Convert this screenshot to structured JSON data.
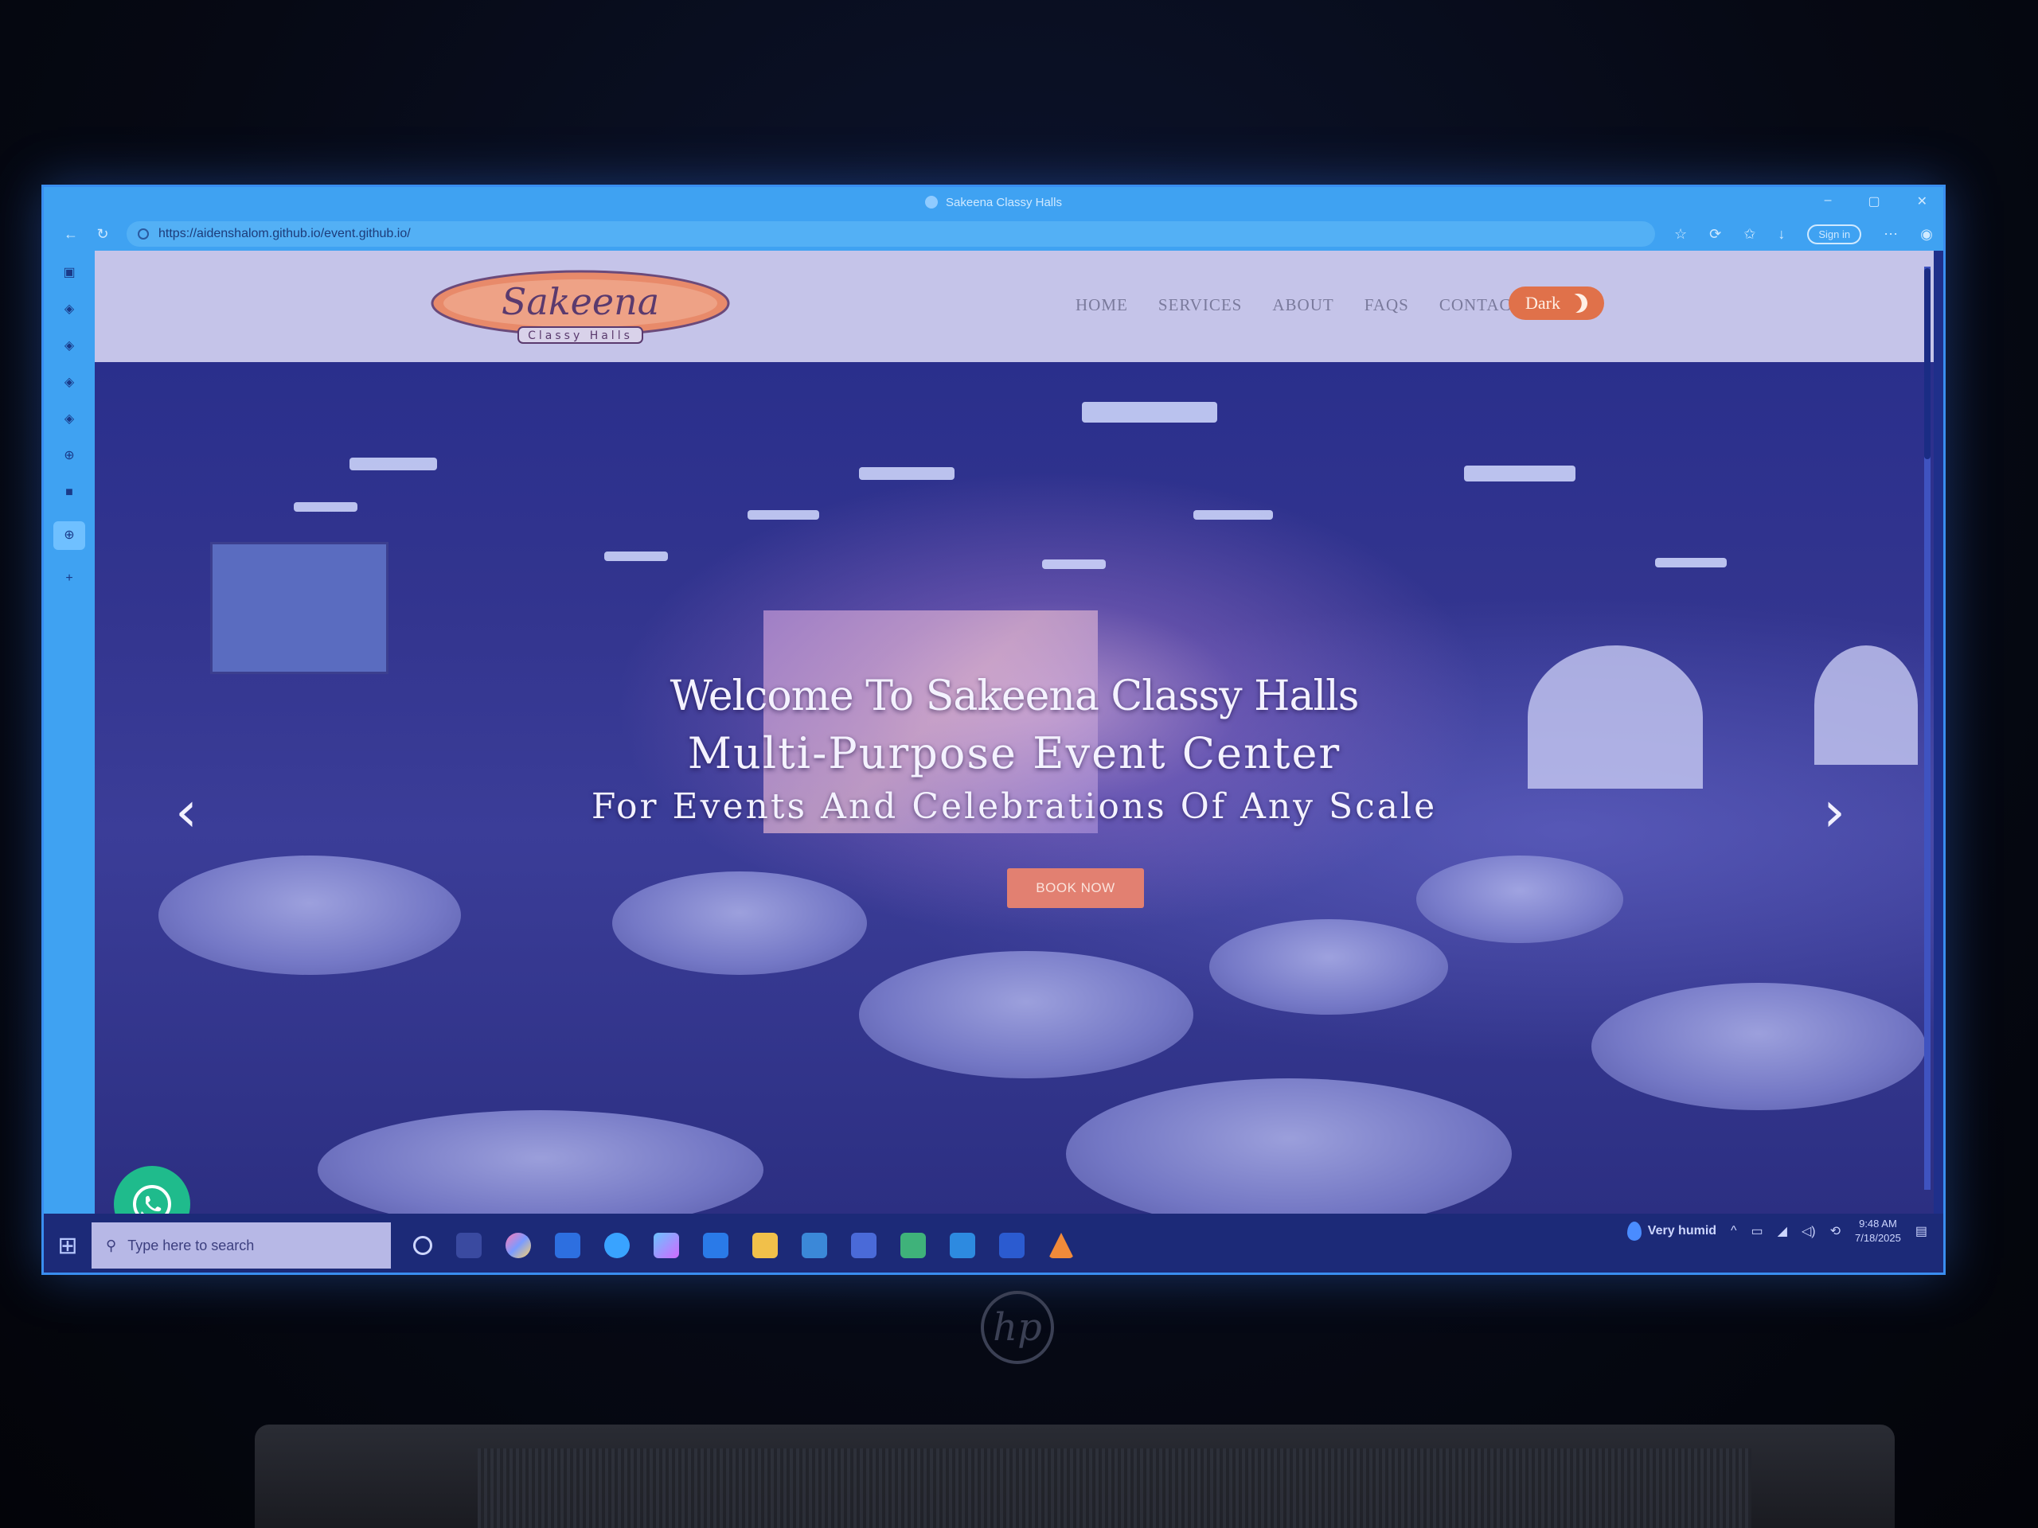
{
  "browser": {
    "tab_title": "Sakeena Classy Halls",
    "url": "https://aidenshalom.github.io/event.github.io/",
    "signin_label": "Sign in"
  },
  "site": {
    "logo": {
      "name": "Sakeena",
      "tagline": "Classy Halls"
    },
    "nav": [
      "HOME",
      "SERVICES",
      "ABOUT",
      "FAQS",
      "CONTACT"
    ],
    "theme_toggle_label": "Dark"
  },
  "hero": {
    "title": "Welcome To Sakeena Classy Halls",
    "subtitle": "Multi-Purpose Event Center",
    "subtitle2": "For Events And Celebrations Of Any Scale",
    "cta_label": "BOOK NOW"
  },
  "taskbar": {
    "search_placeholder": "Type here to search",
    "weather": "Very humid",
    "time": "9:48 AM",
    "date": "7/18/2025"
  },
  "laptop": {
    "brand": "hp"
  },
  "colors": {
    "accent": "#e0714a",
    "header_bg": "#c5c4e9",
    "whatsapp": "#1fbb8c"
  }
}
